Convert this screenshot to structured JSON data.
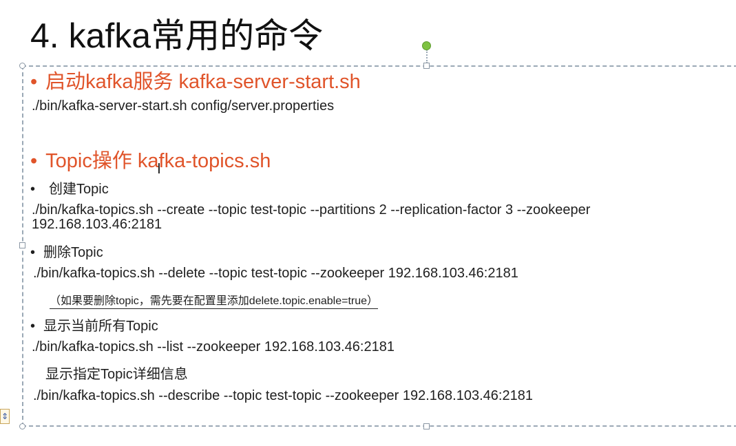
{
  "title": "4. kafka常用的命令",
  "sections": {
    "start_heading": "启动kafka服务 kafka-server-start.sh",
    "start_cmd": "./bin/kafka-server-start.sh config/server.properties",
    "topic_heading": "Topic操作 kafka-topics.sh",
    "create_label": "创建Topic",
    "create_cmd_line1": "./bin/kafka-topics.sh --create --topic test-topic --partitions 2 --replication-factor 3 --zookeeper",
    "create_cmd_line2": "192.168.103.46:2181",
    "delete_label": "删除Topic",
    "delete_cmd": "./bin/kafka-topics.sh --delete --topic test-topic  --zookeeper  192.168.103.46:2181",
    "delete_note": "（如果要删除topic，需先要在配置里添加delete.topic.enable=true）",
    "list_label": "显示当前所有Topic",
    "list_cmd": "./bin/kafka-topics.sh --list --zookeeper  192.168.103.46:2181",
    "describe_label": "显示指定Topic详细信息",
    "describe_cmd": "./bin/kafka-topics.sh --describe  --topic test-topic --zookeeper  192.168.103.46:2181"
  },
  "bullet_glyph": "•",
  "colors": {
    "heading": "#e0542a",
    "body_text": "#1f1f1f",
    "selection_frame": "#9aa8b5",
    "rotate_handle": "#7ec242"
  },
  "icons": [
    "rotate-handle-icon",
    "text-cursor-icon",
    "autofit-options-icon"
  ]
}
